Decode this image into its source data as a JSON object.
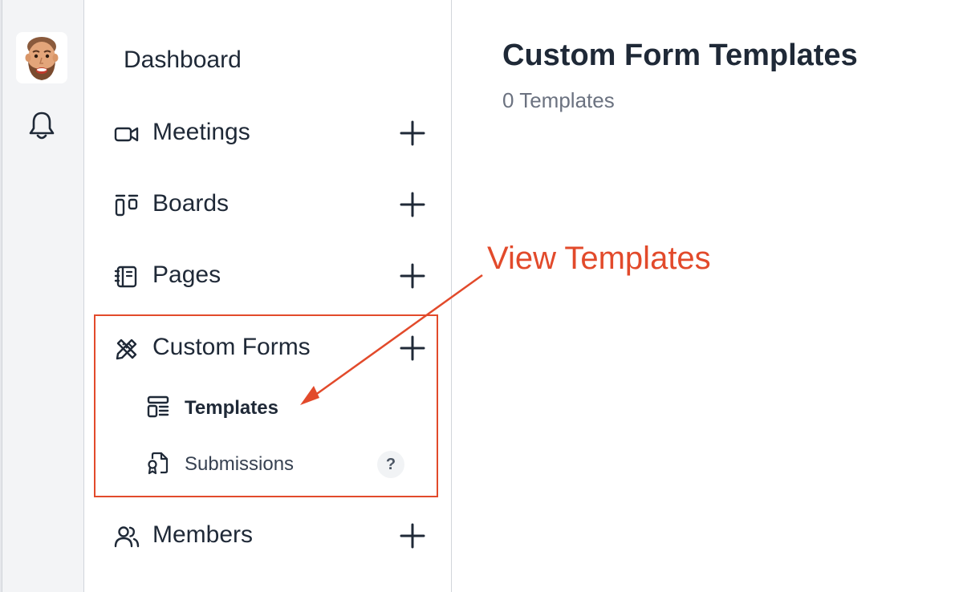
{
  "nav": {
    "dashboard": "Dashboard",
    "items": [
      {
        "label": "Meetings",
        "icon": "video-camera-icon"
      },
      {
        "label": "Boards",
        "icon": "boards-icon"
      },
      {
        "label": "Pages",
        "icon": "notebook-icon"
      },
      {
        "label": "Custom Forms",
        "icon": "pencil-ruler-icon"
      },
      {
        "label": "Members",
        "icon": "users-icon"
      }
    ],
    "custom_forms_children": [
      {
        "label": "Templates",
        "icon": "template-layout-icon",
        "active": true
      },
      {
        "label": "Submissions",
        "icon": "document-award-icon",
        "help": "?"
      }
    ]
  },
  "main": {
    "title": "Custom Form Templates",
    "count": "0 Templates"
  },
  "annotation": {
    "text": "View Templates",
    "color": "#e24a2b"
  }
}
